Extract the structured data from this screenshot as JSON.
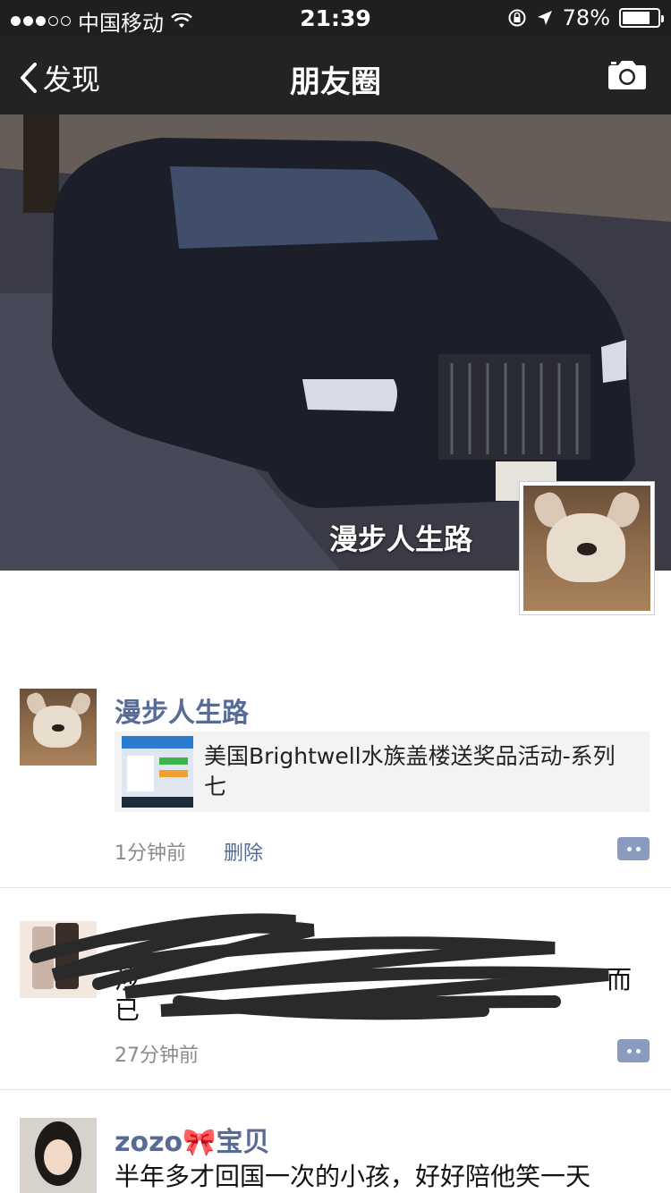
{
  "status_bar": {
    "carrier": "中国移动",
    "time": "21:39",
    "battery": "78%",
    "battery_level": 0.78
  },
  "navbar": {
    "back_label": "发现",
    "title": "朋友圈"
  },
  "cover": {
    "name": "漫步人生路"
  },
  "posts": [
    {
      "author": "漫步人生路",
      "link_title": "美国Brightwell水族盖楼送奖品活动-系列七",
      "time": "1分钟前",
      "delete_label": "删除"
    },
    {
      "author": "",
      "text_start": "涉",
      "text_end": "而",
      "text_line2": "已",
      "time": "27分钟前"
    },
    {
      "author": "zozo🎀宝贝",
      "text": "半年多才回国一次的小孩，好好陪他笑一天"
    }
  ],
  "icons": {
    "back": "chevron-left-icon",
    "camera": "camera-icon",
    "comment": "comment-more-icon"
  }
}
